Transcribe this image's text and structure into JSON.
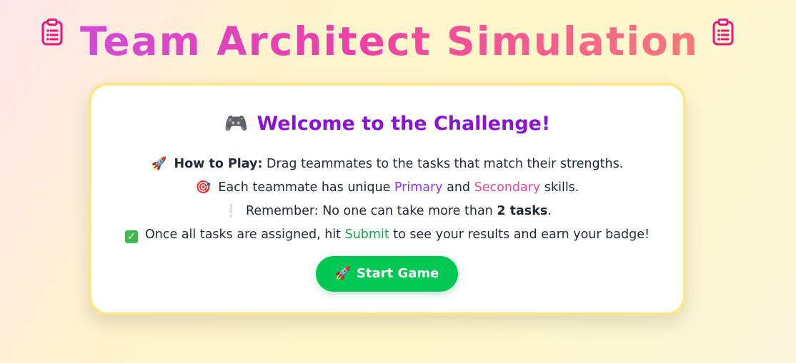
{
  "header": {
    "title": "Team Architect Simulation",
    "left_icon": "clipboard-icon",
    "right_icon": "clipboard-icon"
  },
  "card": {
    "title_emoji": "🎮",
    "title": "Welcome to the Challenge!",
    "rules": [
      {
        "emoji": "🚀",
        "label": "How to Play:",
        "text": " Drag teammates to the tasks that match their strengths."
      },
      {
        "emoji": "🎯",
        "text_before": "Each teammate has unique ",
        "primary": "Primary",
        "text_middle": " and ",
        "secondary": "Secondary",
        "text_after": " skills."
      },
      {
        "emoji": "❕",
        "text_before": "Remember: No one can take more than ",
        "bold": "2 tasks",
        "text_after": "."
      },
      {
        "emoji": "✓",
        "text_before": "Once all tasks are assigned, hit ",
        "submit": "Submit",
        "text_after": " to see your results and earn your badge!"
      }
    ],
    "start_button": {
      "emoji": "🚀",
      "label": "Start Game"
    }
  },
  "colors": {
    "title_gradient_start": "#d14bd6",
    "title_gradient_mid": "#ee3fa6",
    "title_gradient_end": "#f8787a",
    "card_title": "#8a14d6",
    "primary": "#9333ea",
    "secondary": "#ec4899",
    "submit": "#16a34a",
    "button": "#00c853",
    "card_border": "#fde68a",
    "icon": "#e6157a"
  }
}
